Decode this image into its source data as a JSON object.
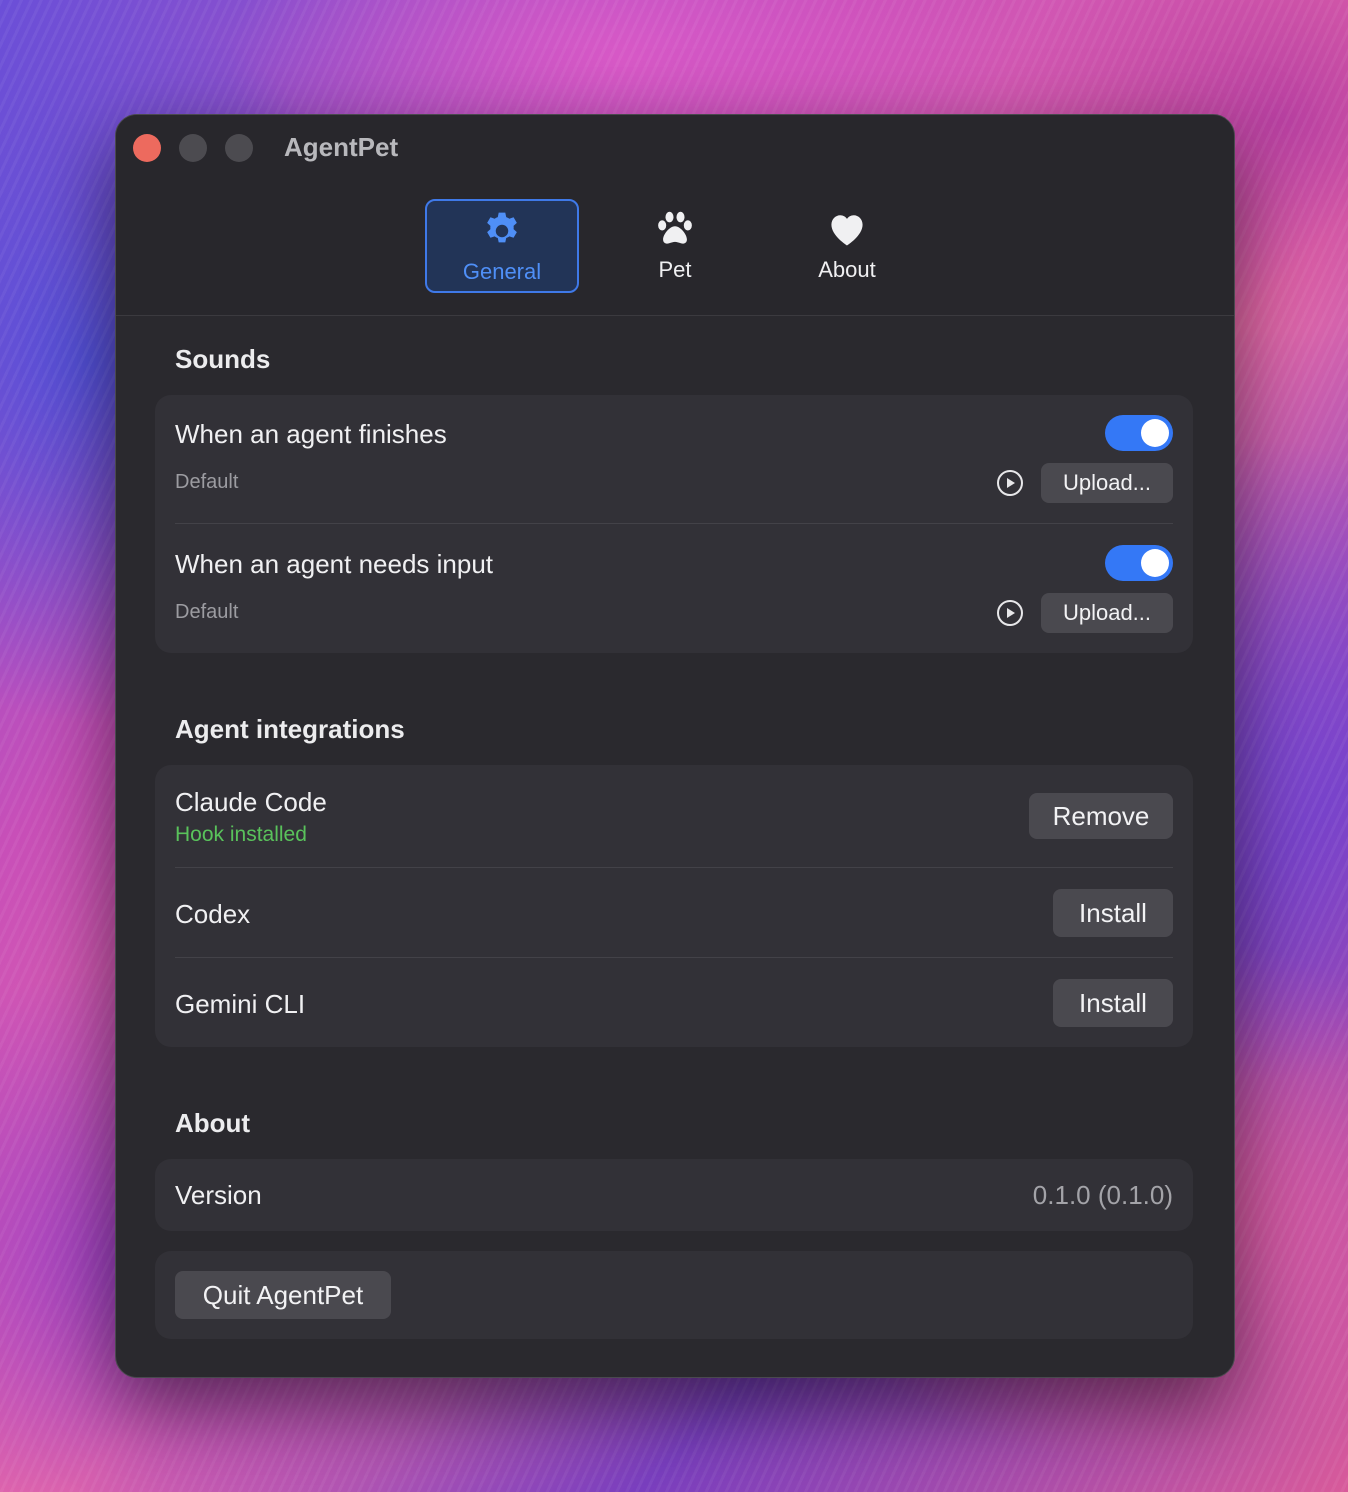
{
  "window": {
    "title": "AgentPet"
  },
  "tabs": [
    {
      "label": "General",
      "icon": "gear-icon",
      "selected": true
    },
    {
      "label": "Pet",
      "icon": "paw-icon",
      "selected": false
    },
    {
      "label": "About",
      "icon": "heart-icon",
      "selected": false
    }
  ],
  "sounds": {
    "section_title": "Sounds",
    "items": [
      {
        "title": "When an agent finishes",
        "sound": "Default",
        "enabled": true,
        "upload_label": "Upload..."
      },
      {
        "title": "When an agent needs input",
        "sound": "Default",
        "enabled": true,
        "upload_label": "Upload..."
      }
    ]
  },
  "integrations": {
    "section_title": "Agent integrations",
    "items": [
      {
        "name": "Claude Code",
        "status": "Hook installed",
        "action": "Remove"
      },
      {
        "name": "Codex",
        "action": "Install"
      },
      {
        "name": "Gemini CLI",
        "action": "Install"
      }
    ]
  },
  "about": {
    "section_title": "About",
    "version_label": "Version",
    "version_value": "0.1.0 (0.1.0)",
    "quit_label": "Quit AgentPet"
  },
  "colors": {
    "accent": "#3478f6",
    "status_green": "#59c25b",
    "window_bg": "#2a292e",
    "card_bg": "#323137"
  }
}
